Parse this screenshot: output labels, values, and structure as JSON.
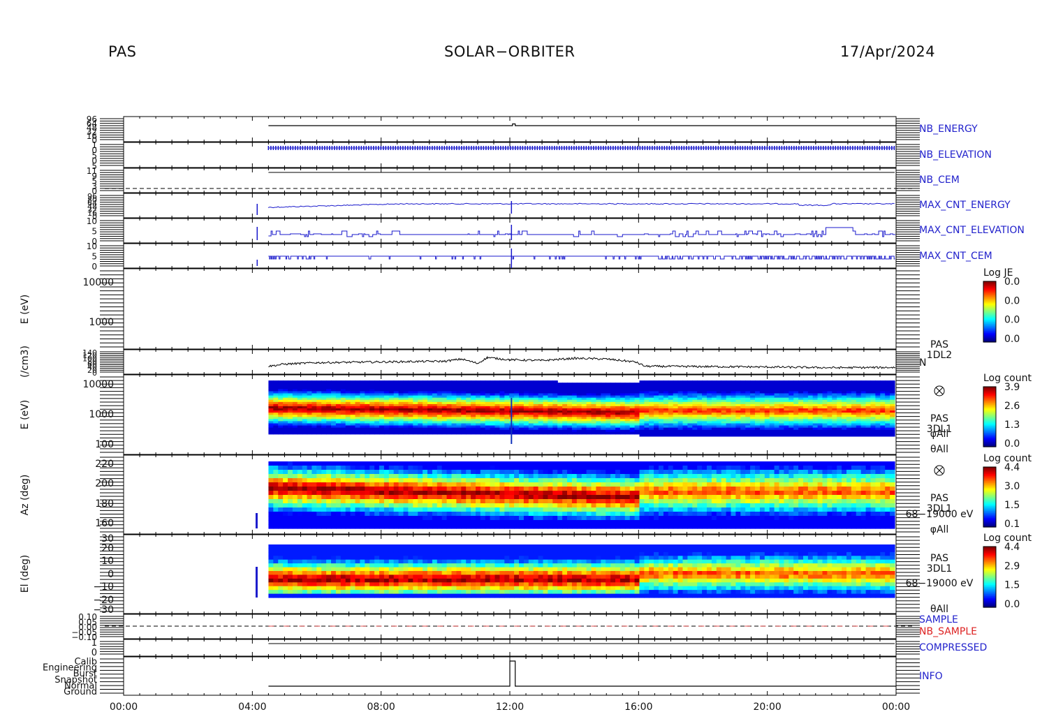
{
  "header": {
    "instrument": "PAS",
    "mission": "SOLAR−ORBITER",
    "date": "17/Apr/2024"
  },
  "colors": {
    "trace_blue": "#1a1acc",
    "label_blue": "#2222cc",
    "label_red": "#dd2222",
    "trace_black": "#000000"
  },
  "time_axis": {
    "start": "00:00",
    "end": "00:00",
    "tick_labels": [
      "00:00",
      "04:00",
      "08:00",
      "12:00",
      "16:00",
      "20:00",
      "00:00"
    ]
  },
  "chart_data": [
    {
      "type": "line",
      "panel": "NB_ENERGY",
      "label": "NB_ENERGY",
      "tick_labels": [
        "96",
        "64",
        "48",
        "32",
        "16",
        "0"
      ],
      "series": [
        {
          "x": [
            "04:30",
            "12:00",
            "12:05",
            "12:10",
            "24:00"
          ],
          "values": [
            64,
            64,
            72,
            64,
            64
          ]
        }
      ]
    },
    {
      "type": "line",
      "panel": "NB_ELEVATION",
      "label": "NB_ELEVATION",
      "tick_labels": [
        "1",
        "0",
        "5",
        "0",
        "5"
      ],
      "note": "dense oscillation between two levels from 04:30 to 24:00"
    },
    {
      "type": "line",
      "panel": "NB_CEM",
      "label": "NB_CEM",
      "tick_labels": [
        "11",
        "9",
        "5",
        "3",
        "0"
      ]
    },
    {
      "type": "line",
      "panel": "MAX_CNT_ENERGY",
      "label": "MAX_CNT_ENERGY",
      "tick_labels": [
        "96",
        "80",
        "64",
        "48",
        "32",
        "16",
        "0"
      ]
    },
    {
      "type": "line",
      "panel": "MAX_CNT_ELEVATION",
      "label": "MAX_CNT_ELEVATION",
      "tick_labels": [
        "10",
        "5",
        "0"
      ]
    },
    {
      "type": "line",
      "panel": "MAX_CNT_CEM",
      "label": "MAX_CNT_CEM",
      "tick_labels": [
        "10",
        "5",
        "0"
      ]
    },
    {
      "type": "heatmap",
      "panel": "E (eV) Log JE",
      "ylabel": "E (eV)",
      "tick_labels": [
        "10000",
        "1000"
      ],
      "colorbar": {
        "title": "Log JE",
        "labels": [
          "0.0",
          "0.0",
          "0.0",
          "0.0"
        ]
      },
      "note": "empty panel"
    },
    {
      "type": "line",
      "panel": "density",
      "ylabel": "(/cm3)",
      "tick_labels": [
        "140",
        "120",
        "100",
        "80",
        "60",
        "40",
        "20",
        "0"
      ],
      "side_label": [
        "PAS",
        "1DL2",
        "N"
      ],
      "series": [
        {
          "name": "N",
          "x_hours": [
            4.5,
            5,
            6,
            8,
            10,
            10.5,
            11,
            11.3,
            12,
            13,
            14,
            15,
            15.9,
            16.2,
            18,
            20,
            22,
            24
          ],
          "values": [
            40,
            55,
            65,
            70,
            75,
            90,
            60,
            100,
            85,
            80,
            95,
            90,
            70,
            40,
            38,
            35,
            30,
            32
          ]
        }
      ]
    },
    {
      "type": "heatmap",
      "panel": "E (eV) Log count",
      "ylabel": "E (eV)",
      "tick_labels": [
        "10000",
        "1000",
        "100"
      ],
      "side_label": [
        "PAS",
        "3DL1",
        "φAll",
        "θAll"
      ],
      "colorbar": {
        "title": "Log count",
        "labels": [
          "3.9",
          "2.6",
          "1.3",
          "0.0"
        ]
      }
    },
    {
      "type": "heatmap",
      "panel": "Az (deg)",
      "ylabel": "Az (deg)",
      "tick_labels": [
        "220",
        "200",
        "180",
        "160"
      ],
      "side_label": [
        "PAS",
        "3DL1",
        "68−19000 eV",
        "φAll"
      ],
      "colorbar": {
        "title": "Log count",
        "labels": [
          "4.4",
          "3.0",
          "1.5",
          "0.1"
        ]
      }
    },
    {
      "type": "heatmap",
      "panel": "El (deg)",
      "ylabel": "El (deg)",
      "tick_labels": [
        "30",
        "20",
        "10",
        "0",
        "−10",
        "−20",
        "−30"
      ],
      "side_label": [
        "PAS",
        "3DL1",
        "68−19000 eV",
        "θAll"
      ],
      "colorbar": {
        "title": "Log count",
        "labels": [
          "4.4",
          "2.9",
          "1.5",
          "0.0"
        ]
      }
    },
    {
      "type": "line",
      "panel": "SAMPLE",
      "labels": [
        "SAMPLE",
        "NB_SAMPLE"
      ],
      "tick_labels": [
        "0.10",
        "0.05",
        "0.00",
        "−0.05",
        "−0.10"
      ]
    },
    {
      "type": "line",
      "panel": "COMPRESSED",
      "label": "COMPRESSED",
      "tick_labels": [
        "1",
        "0"
      ]
    },
    {
      "type": "line",
      "panel": "INFO",
      "label": "INFO",
      "tick_labels": [
        "Calib",
        "Engineering",
        "Burst",
        "Snapshot",
        "Normal",
        "Ground"
      ],
      "series": [
        {
          "x": [
            "04:30",
            "12:00",
            "12:00",
            "12:10",
            "12:10",
            "24:00"
          ],
          "values": [
            "Ground",
            "Ground",
            "Calib",
            "Calib",
            "Ground",
            "Ground"
          ]
        }
      ]
    }
  ]
}
